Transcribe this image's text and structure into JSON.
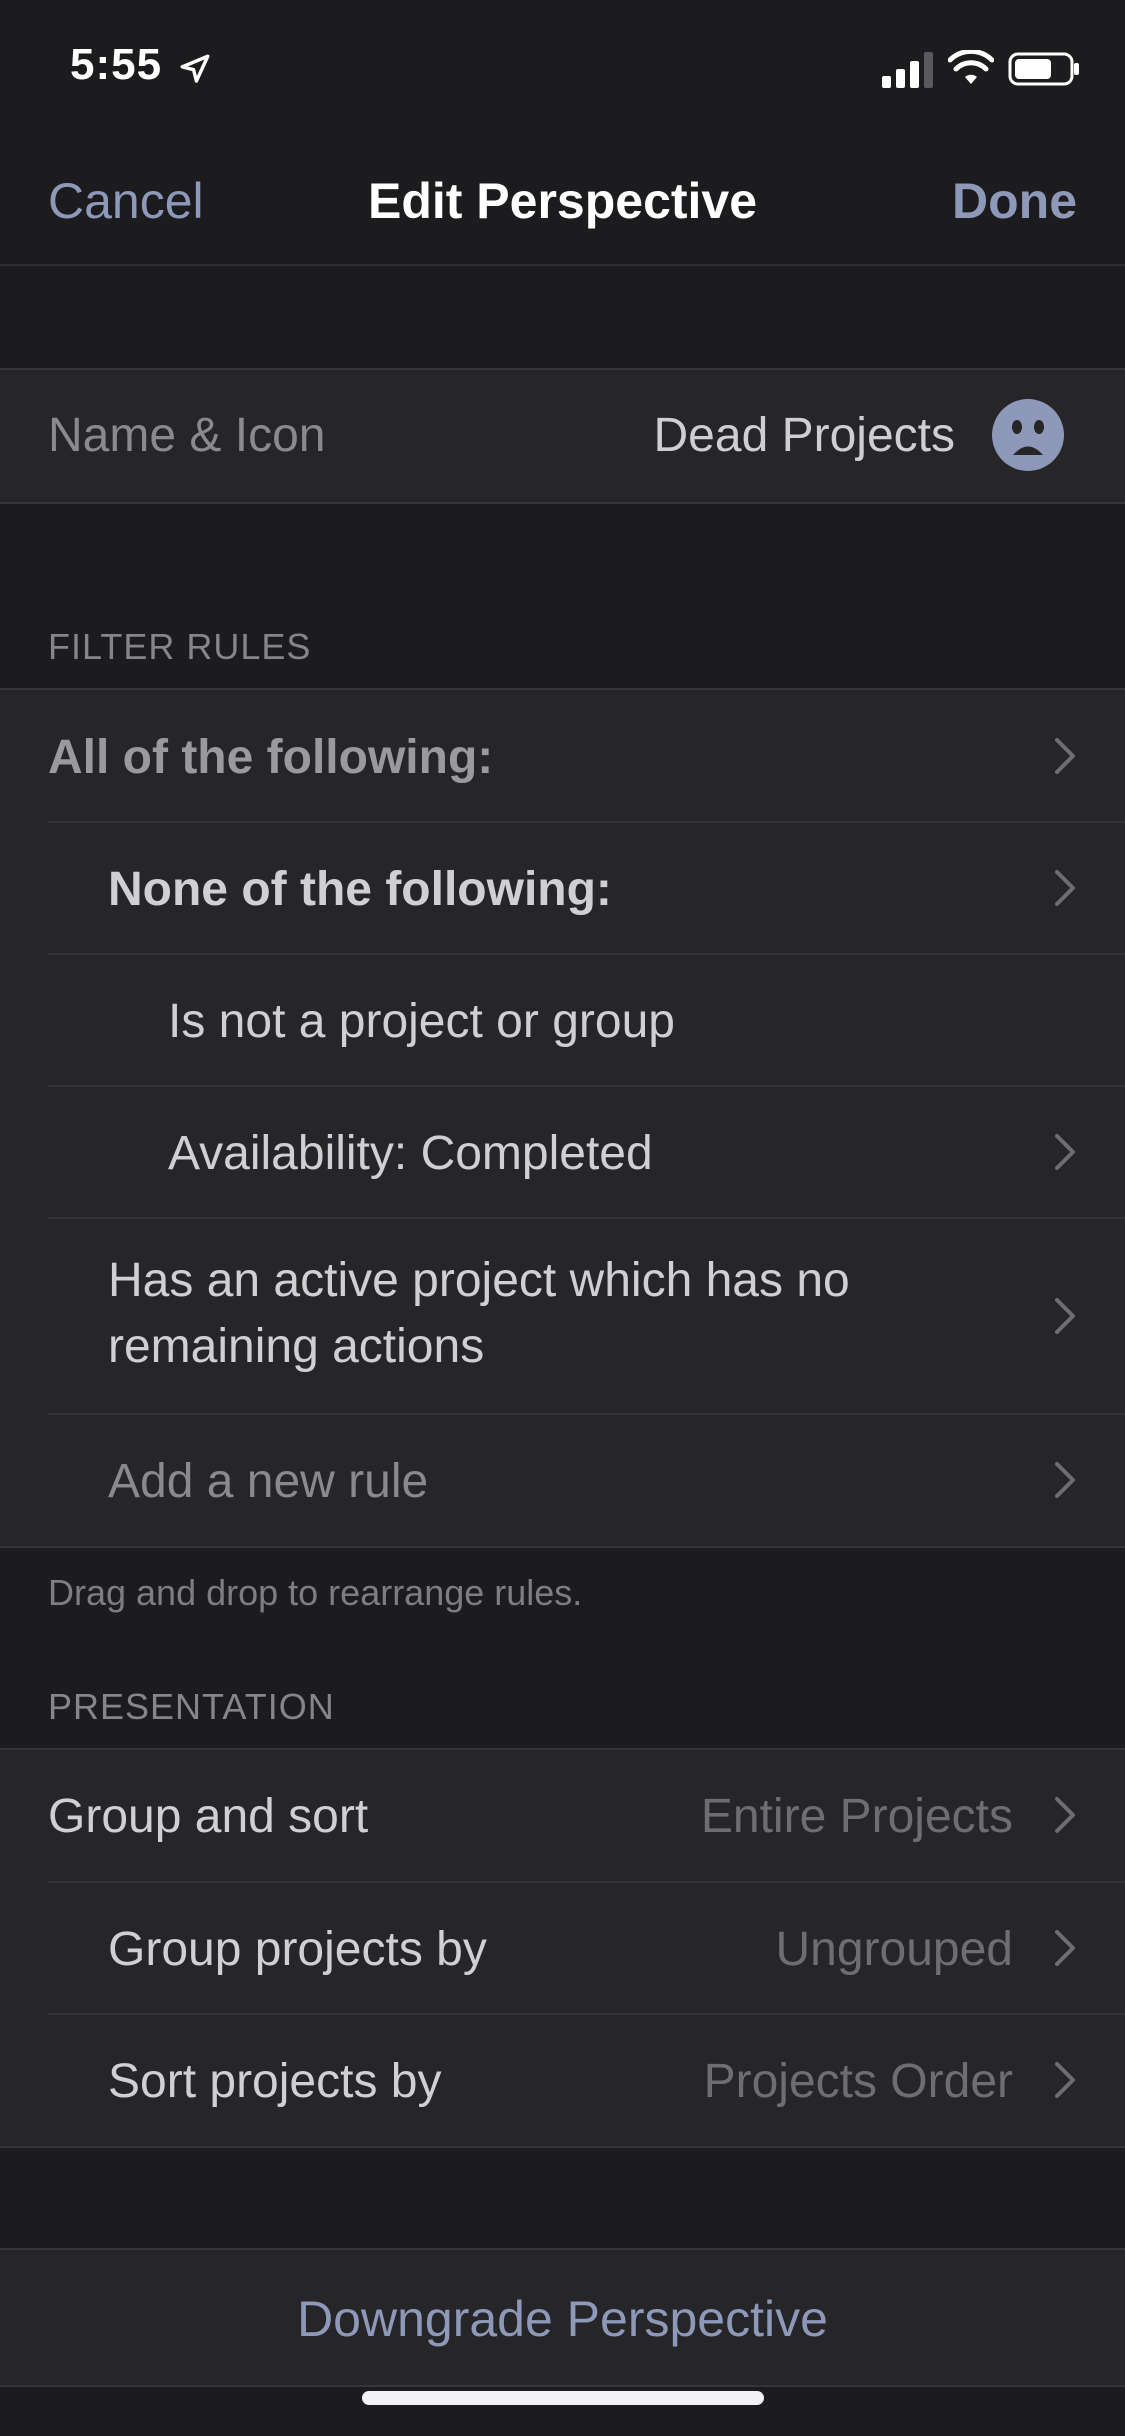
{
  "status_bar": {
    "time": "5:55"
  },
  "nav": {
    "cancel": "Cancel",
    "title": "Edit Perspective",
    "done": "Done"
  },
  "name_icon": {
    "label": "Name & Icon",
    "value": "Dead Projects"
  },
  "filter_rules": {
    "header": "FILTER RULES",
    "items": [
      {
        "label": "All of the following:"
      },
      {
        "label": "None of the following:"
      },
      {
        "label": "Is not a project or group"
      },
      {
        "label": "Availability: Completed"
      },
      {
        "label_line1": "Has an active project which has no",
        "label_line2": "remaining actions"
      },
      {
        "label": "Add a new rule"
      }
    ],
    "footnote": "Drag and drop to rearrange rules."
  },
  "presentation": {
    "header": "PRESENTATION",
    "items": [
      {
        "label": "Group and sort",
        "value": "Entire Projects"
      },
      {
        "label": "Group projects by",
        "value": "Ungrouped"
      },
      {
        "label": "Sort projects by",
        "value": "Projects Order"
      }
    ]
  },
  "bottom": {
    "downgrade": "Downgrade Perspective"
  },
  "colors": {
    "accent": "#8e98b8",
    "background": "#1c1c1e",
    "cell": "#262628"
  }
}
